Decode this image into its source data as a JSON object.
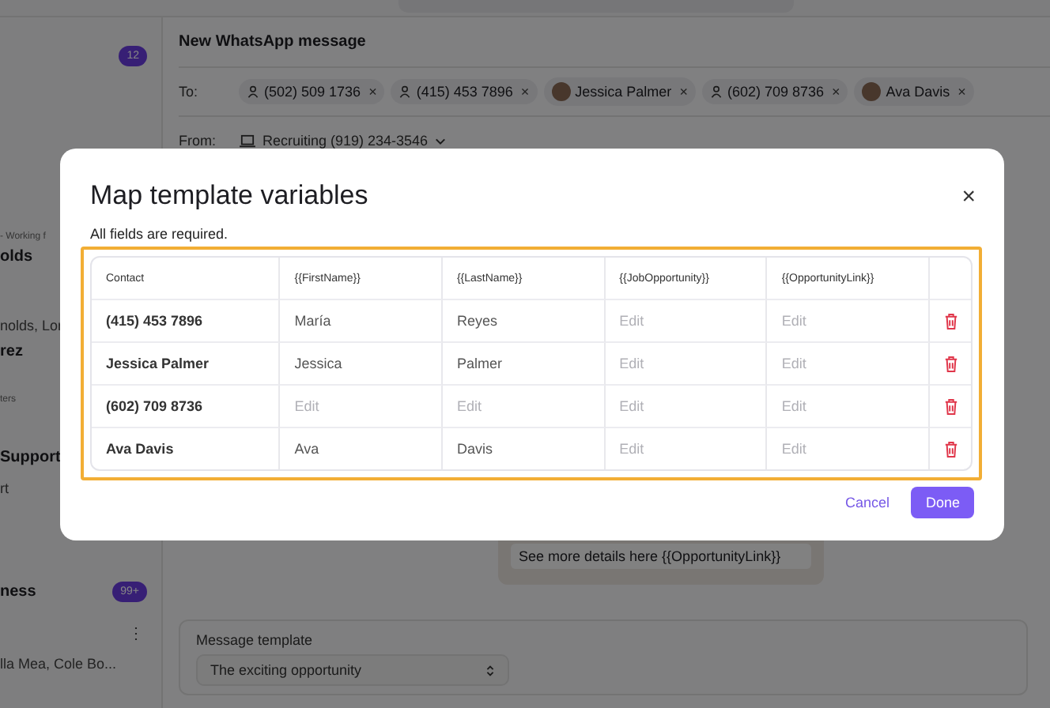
{
  "sidebar": {
    "lines": [
      {
        "kind": "badge",
        "text": "12"
      },
      {
        "kind": "meta",
        "text": "- Working f"
      },
      {
        "kind": "title",
        "text": "olds"
      },
      {
        "kind": "sub",
        "text": "nolds, Lor"
      },
      {
        "kind": "title",
        "text": "rez"
      },
      {
        "kind": "meta",
        "text": "ters"
      },
      {
        "kind": "title",
        "text": "Support"
      },
      {
        "kind": "sub",
        "text": "rt"
      },
      {
        "kind": "title",
        "text": "ness",
        "badge": "99+"
      },
      {
        "kind": "menu",
        "text": "⋮"
      },
      {
        "kind": "sub",
        "text": "lla Mea, Cole Bo..."
      }
    ]
  },
  "composer": {
    "title": "New WhatsApp message",
    "to_label": "To:",
    "recipients": [
      {
        "kind": "phone",
        "label": "(502) 509 1736",
        "remove": "×"
      },
      {
        "kind": "phone",
        "label": "(415) 453 7896",
        "remove": "×"
      },
      {
        "kind": "contact",
        "label": "Jessica Palmer",
        "remove": "×"
      },
      {
        "kind": "phone",
        "label": "(602) 709 8736",
        "remove": "×"
      },
      {
        "kind": "contact",
        "label": "Ava Davis",
        "remove": "×"
      }
    ],
    "from_label": "From:",
    "from_value": "Recruiting (919) 234-3546",
    "bubble_text": "See more details here {{OpportunityLink}}",
    "template_label": "Message template",
    "template_value": "The exciting opportunity"
  },
  "dialog": {
    "title": "Map template variables",
    "close": "×",
    "note": "All fields are required.",
    "columns": [
      "Contact",
      "{{FirstName}}",
      "{{LastName}}",
      "{{JobOpportunity}}",
      "{{OpportunityLink}}"
    ],
    "rows": [
      {
        "cells": [
          {
            "kind": "contact",
            "text": "(415) 453 7896"
          },
          {
            "kind": "field",
            "value": "María"
          },
          {
            "kind": "field",
            "value": "Reyes"
          },
          {
            "kind": "field",
            "placeholder": "Edit"
          },
          {
            "kind": "field",
            "placeholder": "Edit"
          }
        ]
      },
      {
        "cells": [
          {
            "kind": "contact",
            "text": "Jessica Palmer"
          },
          {
            "kind": "field",
            "value": "Jessica"
          },
          {
            "kind": "field",
            "value": "Palmer"
          },
          {
            "kind": "field",
            "placeholder": "Edit"
          },
          {
            "kind": "field",
            "placeholder": "Edit"
          }
        ]
      },
      {
        "cells": [
          {
            "kind": "contact",
            "text": "(602) 709 8736"
          },
          {
            "kind": "field",
            "placeholder": "Edit"
          },
          {
            "kind": "field",
            "placeholder": "Edit"
          },
          {
            "kind": "field",
            "placeholder": "Edit"
          },
          {
            "kind": "field",
            "placeholder": "Edit"
          }
        ]
      },
      {
        "cells": [
          {
            "kind": "contact",
            "text": "Ava Davis"
          },
          {
            "kind": "field",
            "value": "Ava"
          },
          {
            "kind": "field",
            "value": "Davis"
          },
          {
            "kind": "field",
            "placeholder": "Edit"
          },
          {
            "kind": "field",
            "placeholder": "Edit"
          }
        ]
      }
    ],
    "buttons": [
      {
        "kind": "secondary",
        "label": "Cancel"
      },
      {
        "kind": "primary",
        "label": "Done"
      }
    ]
  }
}
